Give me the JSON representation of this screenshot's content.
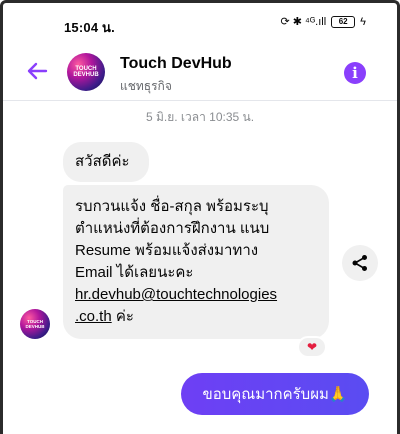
{
  "status_bar": {
    "time": "15:04 น.",
    "icons_text": "⟳ ✱ ⁴ᴳ.ıll",
    "battery": "62"
  },
  "header": {
    "contact_name": "Touch DevHub",
    "contact_subtitle": "แชทธุรกิจ",
    "avatar_text_line1": "TOUCH",
    "avatar_text_line2": "DEVHUB",
    "info_glyph": "i"
  },
  "chat": {
    "timestamp": "5 มิ.ย. เวลา 10:35 น.",
    "messages": [
      {
        "text": "สวัสดีค่ะ"
      },
      {
        "line1": "รบกวนแจ้ง ชื่อ-สกุล  พร้อมระบุ",
        "line2": "ตำแหน่งที่ต้องการฝึกงาน แนบ",
        "line3": "Resume พร้อมแจ้งส่งมาทาง",
        "line4": "Email ได้เลยนะคะ",
        "link_line1": "hr.devhub@touchtechnologies",
        "link_line2": ".co.th",
        "suffix": " ค่ะ"
      }
    ],
    "reaction": "❤",
    "outgoing": "ขอบคุณมากครับผม🙏"
  },
  "colors": {
    "accent": "#8a3ffc",
    "outgoing_bubble": "#6a43f5",
    "incoming_bubble": "#f0f0f0",
    "reaction": "#e41e3f"
  }
}
